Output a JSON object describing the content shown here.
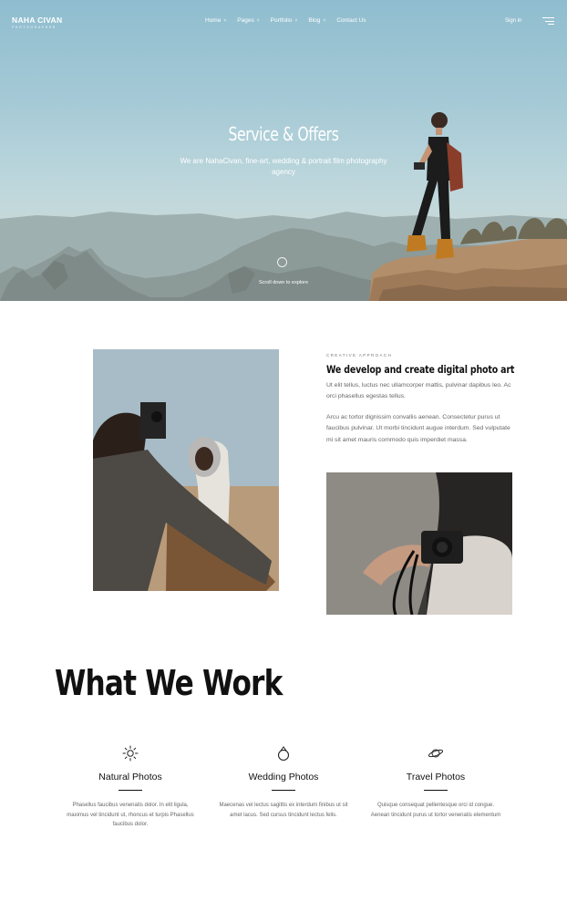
{
  "brand": {
    "name": "NAHA CIVAN",
    "tagline": "PHOTOGRAPHER"
  },
  "nav": [
    {
      "label": "Home",
      "chevron": "˅"
    },
    {
      "label": "Pages",
      "chevron": "˅"
    },
    {
      "label": "Portfolio",
      "chevron": "˅"
    },
    {
      "label": "Blog",
      "chevron": "˅"
    },
    {
      "label": "Contact Us",
      "chevron": ""
    }
  ],
  "header": {
    "signin": "Sign in",
    "menu_icon": "hamburger-icon"
  },
  "hero": {
    "title": "Service & Offers",
    "subtitle": "We are NahaCivan, fine-art, wedding & portrait film photography agency",
    "scroll_text": "Scroll down to explore"
  },
  "about": {
    "eyebrow": "CREATIVE APPROACH",
    "title": "We develop and create digital photo art",
    "paragraph1": "Ut elit tellus, luctus nec ullamcorper mattis, pulvinar dapibus leo. Ac orci phasellus egestas tellus.",
    "paragraph2": "Arcu ac tortor dignissim convallis aenean. Consectetur purus ut faucibus pulvinar. Ut morbi tincidunt augue interdum. Sed vulputate mi sit amet mauris commodo quis imperdiet massa."
  },
  "work": {
    "title": "What We Work",
    "services": [
      {
        "icon": "sun-icon",
        "label": "Natural Photos",
        "desc": "Phasellus faucibus venenatis dolor. In elit ligula, maximus vel tincidunt ut, rhoncus et turpis Phasellus faucibus dolor."
      },
      {
        "icon": "ring-icon",
        "label": "Wedding Photos",
        "desc": "Maecenas vel lectus sagittis ex interdum finibus ut sit amet lacus. Sed cursus tincidunt lectus felis."
      },
      {
        "icon": "planet-icon",
        "label": "Travel Photos",
        "desc": "Quisque consequat pellentesque orci id congue. Aenean tincidunt purus ut tortor venenatis elementum"
      }
    ]
  }
}
